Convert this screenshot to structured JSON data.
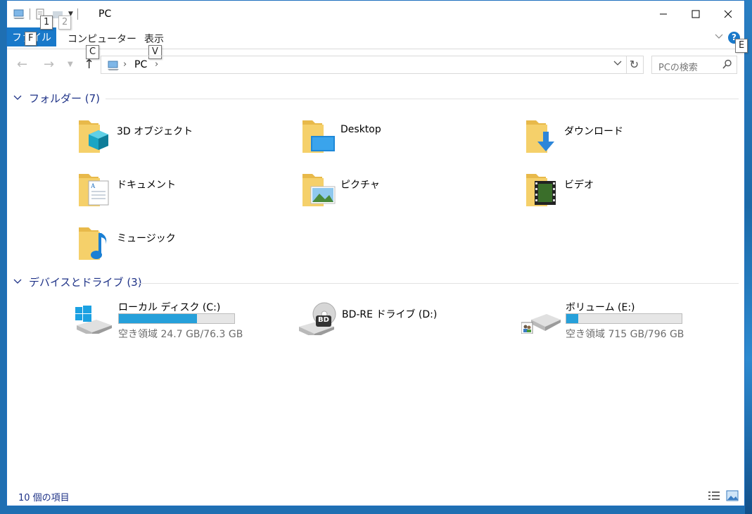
{
  "window": {
    "title": "PC",
    "keytips": {
      "qat1": "1",
      "qat2": "2",
      "file": "F",
      "computer": "C",
      "view": "V",
      "help": "E"
    }
  },
  "ribbon": {
    "file_label": "ファイル",
    "tabs": [
      {
        "label": "コンピューター"
      },
      {
        "label": "表示"
      }
    ],
    "help_label": "?"
  },
  "nav": {
    "address_location": "PC",
    "search_placeholder": "PCの検索"
  },
  "groups": {
    "folders": {
      "title": "フォルダー (7)",
      "items": [
        {
          "label": "3D オブジェクト",
          "icon": "3d-objects-folder-icon"
        },
        {
          "label": "Desktop",
          "icon": "desktop-folder-icon"
        },
        {
          "label": "ダウンロード",
          "icon": "downloads-folder-icon"
        },
        {
          "label": "ドキュメント",
          "icon": "documents-folder-icon"
        },
        {
          "label": "ピクチャ",
          "icon": "pictures-folder-icon"
        },
        {
          "label": "ビデオ",
          "icon": "videos-folder-icon"
        },
        {
          "label": "ミュージック",
          "icon": "music-folder-icon"
        }
      ]
    },
    "drives": {
      "title": "デバイスとドライブ (3)",
      "items": [
        {
          "label": "ローカル ディスク (C:)",
          "free_text": "空き領域 24.7 GB/76.3 GB",
          "used_fraction": 0.676,
          "icon": "windows-drive-icon"
        },
        {
          "label": "BD-RE ドライブ (D:)",
          "icon": "bd-drive-icon",
          "badge": "BD"
        },
        {
          "label": "ボリューム (E:)",
          "free_text": "空き領域 715 GB/796 GB",
          "used_fraction": 0.102,
          "icon": "network-volume-icon"
        }
      ]
    }
  },
  "status": {
    "item_count": "10 個の項目"
  },
  "colors": {
    "accent": "#1979ca",
    "group_header": "#1e3287",
    "usage_bar": "#26a0da"
  }
}
